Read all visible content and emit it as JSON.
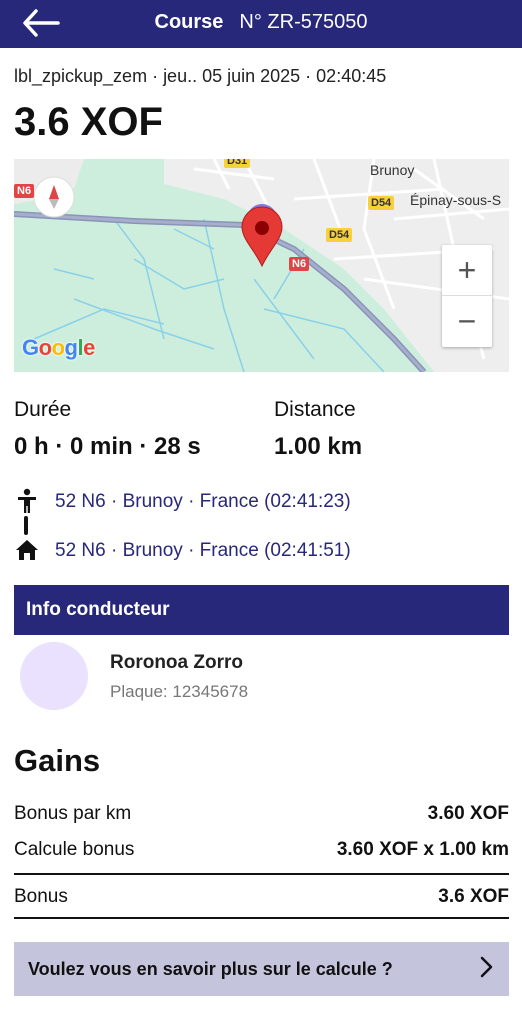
{
  "header": {
    "title": "Course",
    "course_number": "N° ZR-575050"
  },
  "meta": {
    "text": "lbl_zpickup_zem  · jeu.. 05 juin 2025 · 02:40:45"
  },
  "price": "3.6 XOF",
  "map": {
    "place_labels": [
      "Brunoy",
      "Épinay-sous-S"
    ],
    "road_labels": [
      "D31",
      "D54",
      "D54",
      "N6",
      "N6"
    ],
    "zoom_in": "+",
    "zoom_out": "−",
    "attribution": "Google"
  },
  "stats": {
    "duration_label": "Durée",
    "duration_value": "0 h · 0 min · 28 s",
    "distance_label": "Distance",
    "distance_value": "1.00 km"
  },
  "route": {
    "pickup": "52 N6 · Brunoy · France (02:41:23)",
    "dropoff": "52 N6 · Brunoy · France (02:41:51)"
  },
  "driver": {
    "section_title": "Info conducteur",
    "name": "Roronoa Zorro",
    "plate": "Plaque: 12345678"
  },
  "gains": {
    "title": "Gains",
    "rows": [
      {
        "label": "Bonus par km",
        "value": "3.60 XOF"
      },
      {
        "label": "Calcule bonus",
        "value": "3.60 XOF x 1.00 km"
      }
    ],
    "total": {
      "label": "Bonus",
      "value": "3.6 XOF"
    }
  },
  "cta": {
    "label": "Voulez vous en savoir plus sur le calcule ?"
  },
  "colors": {
    "primary": "#27287a",
    "map_green": "#cdeedd",
    "cta_bg": "#c4c4dc",
    "avatar_bg": "#e9e1fd"
  }
}
